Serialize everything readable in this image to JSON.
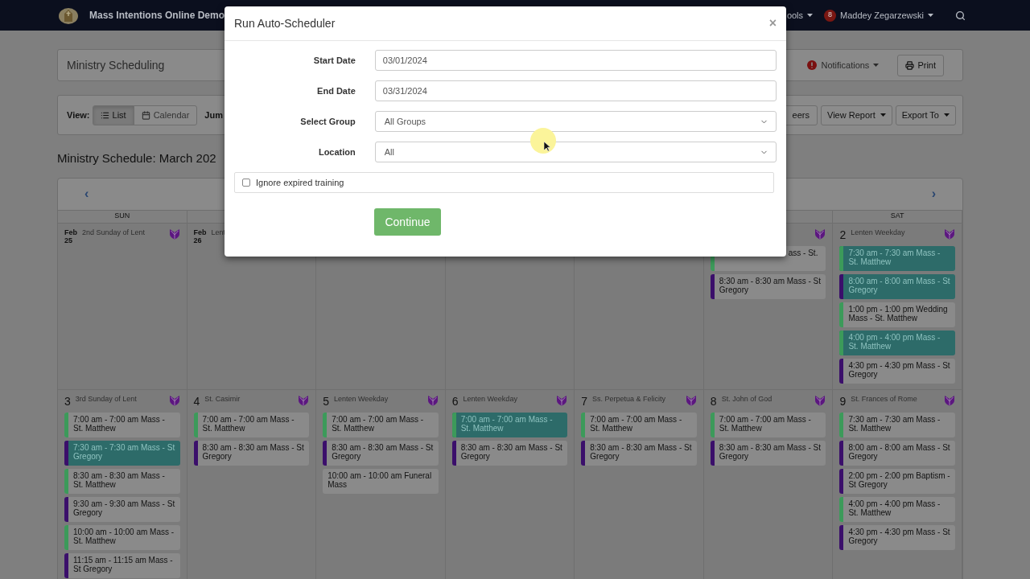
{
  "navbar": {
    "title": "Mass Intentions Online Demo",
    "tools_menu": "ools",
    "user_badge": "8",
    "user": "Maddey Zegarzewski"
  },
  "page_header": {
    "title": "Ministry Scheduling",
    "notifications": "Notifications",
    "print": "Print"
  },
  "toolbar": {
    "view_label": "View:",
    "views": [
      {
        "label": "List",
        "selected": true
      },
      {
        "label": "Calendar",
        "selected": false
      }
    ],
    "jump_label": "Jum",
    "buttons": [
      {
        "label": "eers",
        "dropdown": false
      },
      {
        "label": "View Report",
        "dropdown": true
      },
      {
        "label": "Export To",
        "dropdown": true
      }
    ]
  },
  "schedule_title": "Ministry Schedule: March 202",
  "calendar": {
    "prev": "‹",
    "next": "›",
    "headers": {
      "sun": "SUN",
      "sat": "SAT"
    },
    "weeks": [
      {
        "days": [
          {
            "kind": "day",
            "month": "Feb",
            "day": "25",
            "feast": "2nd Sunday of Lent",
            "season_icon": true
          },
          {
            "kind": "day",
            "month": "Feb",
            "day": "26",
            "feast": "Lent"
          },
          {
            "kind": "covered"
          },
          {
            "kind": "covered"
          },
          {
            "kind": "covered"
          },
          {
            "kind": "day",
            "season_icon": true,
            "events": [
              {
                "kind": "cut",
                "text": "ass - St.",
                "color": "#3c9a5a",
                "highlighted": false
              },
              {
                "kind": "full",
                "text": "8:30 am - 8:30 am Mass - St Gregory",
                "color": "#3b0f6b",
                "highlighted": false
              }
            ]
          },
          {
            "kind": "day",
            "day": "2",
            "feast": "Lenten Weekday",
            "season_icon": true,
            "events": [
              {
                "kind": "full",
                "text": "7:30 am - 7:30 am Mass - St. Matthew",
                "color": "#3c9a5a",
                "highlighted": true
              },
              {
                "kind": "full",
                "text": "8:00 am - 8:00 am Mass - St Gregory",
                "color": "#3b0f6b",
                "highlighted": true
              },
              {
                "kind": "full",
                "text": "1:00 pm - 1:00 pm Wedding Mass - St. Matthew",
                "color": "#3c9a5a",
                "highlighted": false
              },
              {
                "kind": "full",
                "text": "4:00 pm - 4:00 pm Mass - St. Matthew",
                "color": "#3c9a5a",
                "highlighted": true
              },
              {
                "kind": "full",
                "text": "4:30 pm - 4:30 pm Mass - St Gregory",
                "color": "#3b0f6b",
                "highlighted": false
              }
            ]
          }
        ]
      },
      {
        "days": [
          {
            "kind": "day",
            "day": "3",
            "feast": "3rd Sunday of Lent",
            "season_icon": true,
            "events": [
              {
                "kind": "full",
                "text": "7:00 am - 7:00 am Mass - St. Matthew",
                "color": "#3c9a5a",
                "highlighted": false
              },
              {
                "kind": "full",
                "text": "7:30 am - 7:30 am Mass - St Gregory",
                "color": "#3b0f6b",
                "highlighted": true
              },
              {
                "kind": "full",
                "text": "8:30 am - 8:30 am Mass - St. Matthew",
                "color": "#3c9a5a",
                "highlighted": false
              },
              {
                "kind": "full",
                "text": "9:30 am - 9:30 am Mass - St Gregory",
                "color": "#3b0f6b",
                "highlighted": false
              },
              {
                "kind": "full",
                "text": "10:00 am - 10:00 am Mass - St. Matthew",
                "color": "#3c9a5a",
                "highlighted": false
              },
              {
                "kind": "full",
                "text": "11:15 am - 11:15 am Mass - St Gregory",
                "color": "#3b0f6b",
                "highlighted": false
              }
            ]
          },
          {
            "kind": "day",
            "day": "4",
            "feast": "St. Casimir",
            "season_icon": true,
            "events": [
              {
                "kind": "full",
                "text": "7:00 am - 7:00 am Mass - St. Matthew",
                "color": "#3c9a5a",
                "highlighted": false
              },
              {
                "kind": "full",
                "text": "8:30 am - 8:30 am Mass - St Gregory",
                "color": "#3b0f6b",
                "highlighted": false
              }
            ]
          },
          {
            "kind": "day",
            "day": "5",
            "feast": "Lenten Weekday",
            "season_icon": true,
            "events": [
              {
                "kind": "full",
                "text": "7:00 am - 7:00 am Mass - St. Matthew",
                "color": "#3c9a5a",
                "highlighted": false
              },
              {
                "kind": "full",
                "text": "8:30 am - 8:30 am Mass - St Gregory",
                "color": "#3b0f6b",
                "highlighted": false
              },
              {
                "kind": "full",
                "text": "10:00 am - 10:00 am Funeral Mass",
                "highlighted": false
              }
            ]
          },
          {
            "kind": "day",
            "day": "6",
            "feast": "Lenten Weekday",
            "season_icon": true,
            "events": [
              {
                "kind": "full",
                "text": "7:00 am - 7:00 am Mass - St. Matthew",
                "color": "#3c9a5a",
                "highlighted": true
              },
              {
                "kind": "full",
                "text": "8:30 am - 8:30 am Mass - St Gregory",
                "color": "#3b0f6b",
                "highlighted": false
              }
            ]
          },
          {
            "kind": "day",
            "day": "7",
            "feast": "Ss. Perpetua & Felicity",
            "season_icon": true,
            "events": [
              {
                "kind": "full",
                "text": "7:00 am - 7:00 am Mass - St. Matthew",
                "color": "#3c9a5a",
                "highlighted": false
              },
              {
                "kind": "full",
                "text": "8:30 am - 8:30 am Mass - St Gregory",
                "color": "#3b0f6b",
                "highlighted": false
              }
            ]
          },
          {
            "kind": "day",
            "day": "8",
            "feast": "St. John of God",
            "season_icon": true,
            "events": [
              {
                "kind": "full",
                "text": "7:00 am - 7:00 am Mass - St. Matthew",
                "color": "#3c9a5a",
                "highlighted": false
              },
              {
                "kind": "full",
                "text": "8:30 am - 8:30 am Mass - St Gregory",
                "color": "#3b0f6b",
                "highlighted": false
              }
            ]
          },
          {
            "kind": "day",
            "day": "9",
            "feast": "St. Frances of Rome",
            "season_icon": true,
            "events": [
              {
                "kind": "full",
                "text": "7:30 am - 7:30 am Mass - St. Matthew",
                "color": "#3c9a5a",
                "highlighted": false
              },
              {
                "kind": "full",
                "text": "8:00 am - 8:00 am Mass - St Gregory",
                "color": "#3b0f6b",
                "highlighted": false
              },
              {
                "kind": "full",
                "text": "2:00 pm - 2:00 pm Baptism - St Gregory",
                "color": "#3b0f6b",
                "highlighted": false
              },
              {
                "kind": "full",
                "text": "4:00 pm - 4:00 pm Mass - St. Matthew",
                "color": "#3c9a5a",
                "highlighted": false
              },
              {
                "kind": "full",
                "text": "4:30 pm - 4:30 pm Mass - St Gregory",
                "color": "#3b0f6b",
                "highlighted": false
              }
            ]
          }
        ]
      }
    ]
  },
  "modal": {
    "title": "Run Auto-Scheduler",
    "close": "×",
    "fields": [
      {
        "kind": "text",
        "label": "Start Date",
        "value": "03/01/2024"
      },
      {
        "kind": "text",
        "label": "End Date",
        "value": "03/31/2024"
      },
      {
        "kind": "select",
        "label": "Select Group",
        "value": "All Groups"
      },
      {
        "kind": "select",
        "label": "Location",
        "value": "All"
      }
    ],
    "checkbox": {
      "label": "Ignore expired training",
      "checked": false
    },
    "submit": "Continue"
  }
}
